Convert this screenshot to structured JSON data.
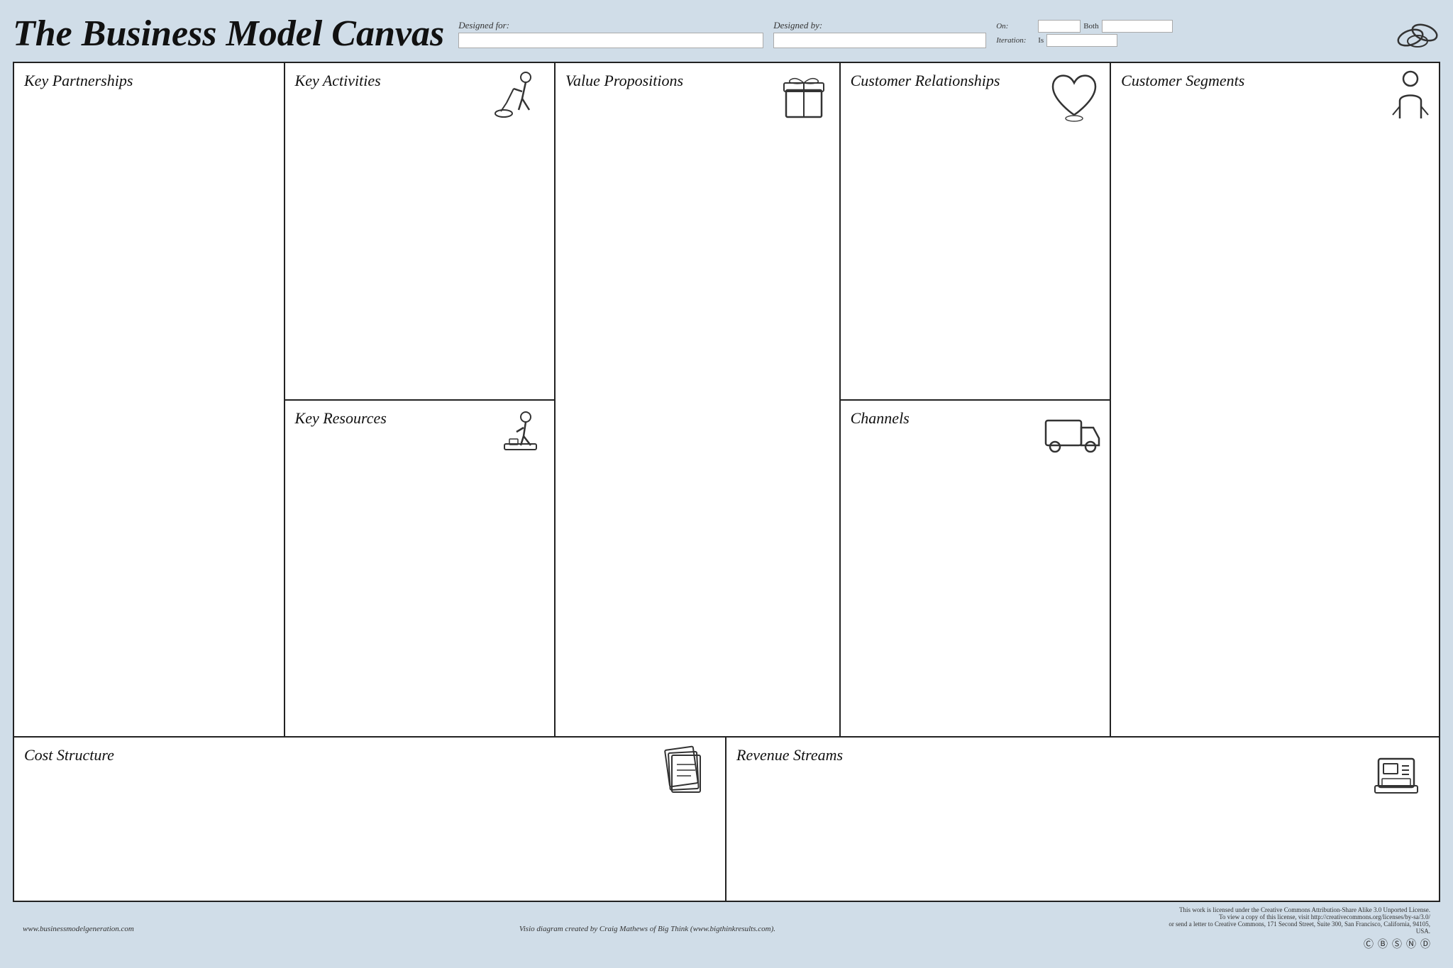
{
  "header": {
    "title": "The Business Model Canvas",
    "designed_for_label": "Designed for:",
    "designed_by_label": "Designed by:",
    "on_label": "On:",
    "both_label": "Both",
    "iteration_label": "Iteration:",
    "is_label": "Is"
  },
  "canvas": {
    "partnerships_label": "Key Partnerships",
    "activities_label": "Key Activities",
    "resources_label": "Key Resources",
    "value_label": "Value Propositions",
    "cr_label": "Customer Relationships",
    "channels_label": "Channels",
    "segments_label": "Customer Segments",
    "cost_label": "Cost Structure",
    "revenue_label": "Revenue Streams"
  },
  "footer": {
    "left": "www.businessmodelgeneration.com",
    "center": "Visio diagram created by Craig Mathews of Big Think (www.bigthinkresults.com).",
    "right_line1": "This work is licensed under the Creative Commons Attribution-Share Alike 3.0 Unported License.",
    "right_line2": "To view a copy of this license, visit http://creativecommons.org/licenses/by-sa/3.0/",
    "right_line3": "or send a letter to Creative Commons, 171 Second Street, Suite 300, San Francisco, California, 94105, USA."
  }
}
